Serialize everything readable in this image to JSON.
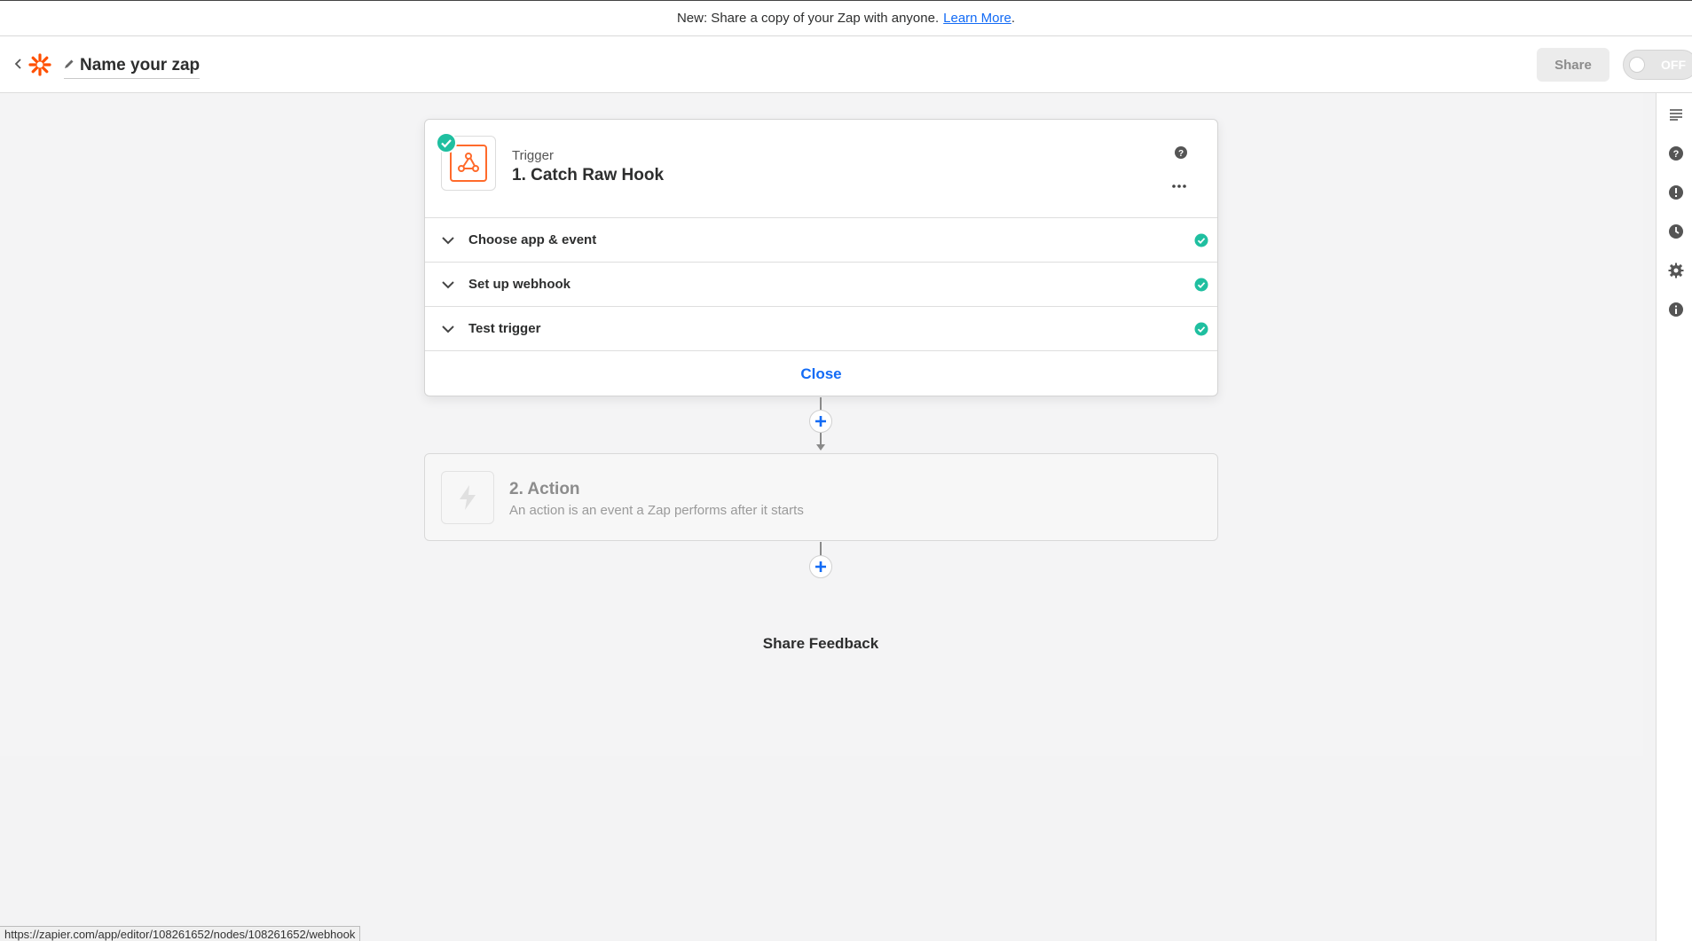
{
  "announcement": {
    "text": "New: Share a copy of your Zap with anyone.",
    "link": "Learn More",
    "suffix": "."
  },
  "header": {
    "zap_name": "Name your zap",
    "share_label": "Share",
    "toggle_label": "OFF"
  },
  "trigger": {
    "kind": "Trigger",
    "title": "1. Catch Raw Hook",
    "rows": [
      {
        "label": "Choose app & event"
      },
      {
        "label": "Set up webhook"
      },
      {
        "label": "Test trigger"
      }
    ],
    "close_label": "Close"
  },
  "action": {
    "title": "2. Action",
    "description": "An action is an event a Zap performs after it starts"
  },
  "feedback_label": "Share Feedback",
  "status_url": "https://zapier.com/app/editor/108261652/nodes/108261652/webhook",
  "colors": {
    "accent": "#136bf5",
    "brand": "#ff4f00",
    "success": "#1fbfa0"
  },
  "icons": {
    "back": "chevron-left-icon",
    "logo": "zapier-logo",
    "edit": "pencil-icon",
    "webhook": "webhook-icon",
    "success": "check-circle-icon",
    "help": "question-circle-icon",
    "more": "ellipsis-icon",
    "expand": "chevron-down-icon",
    "add": "plus-icon",
    "action": "bolt-icon",
    "rail": [
      "outline-icon",
      "help-icon",
      "alert-icon",
      "history-icon",
      "settings-icon",
      "info-icon"
    ]
  }
}
